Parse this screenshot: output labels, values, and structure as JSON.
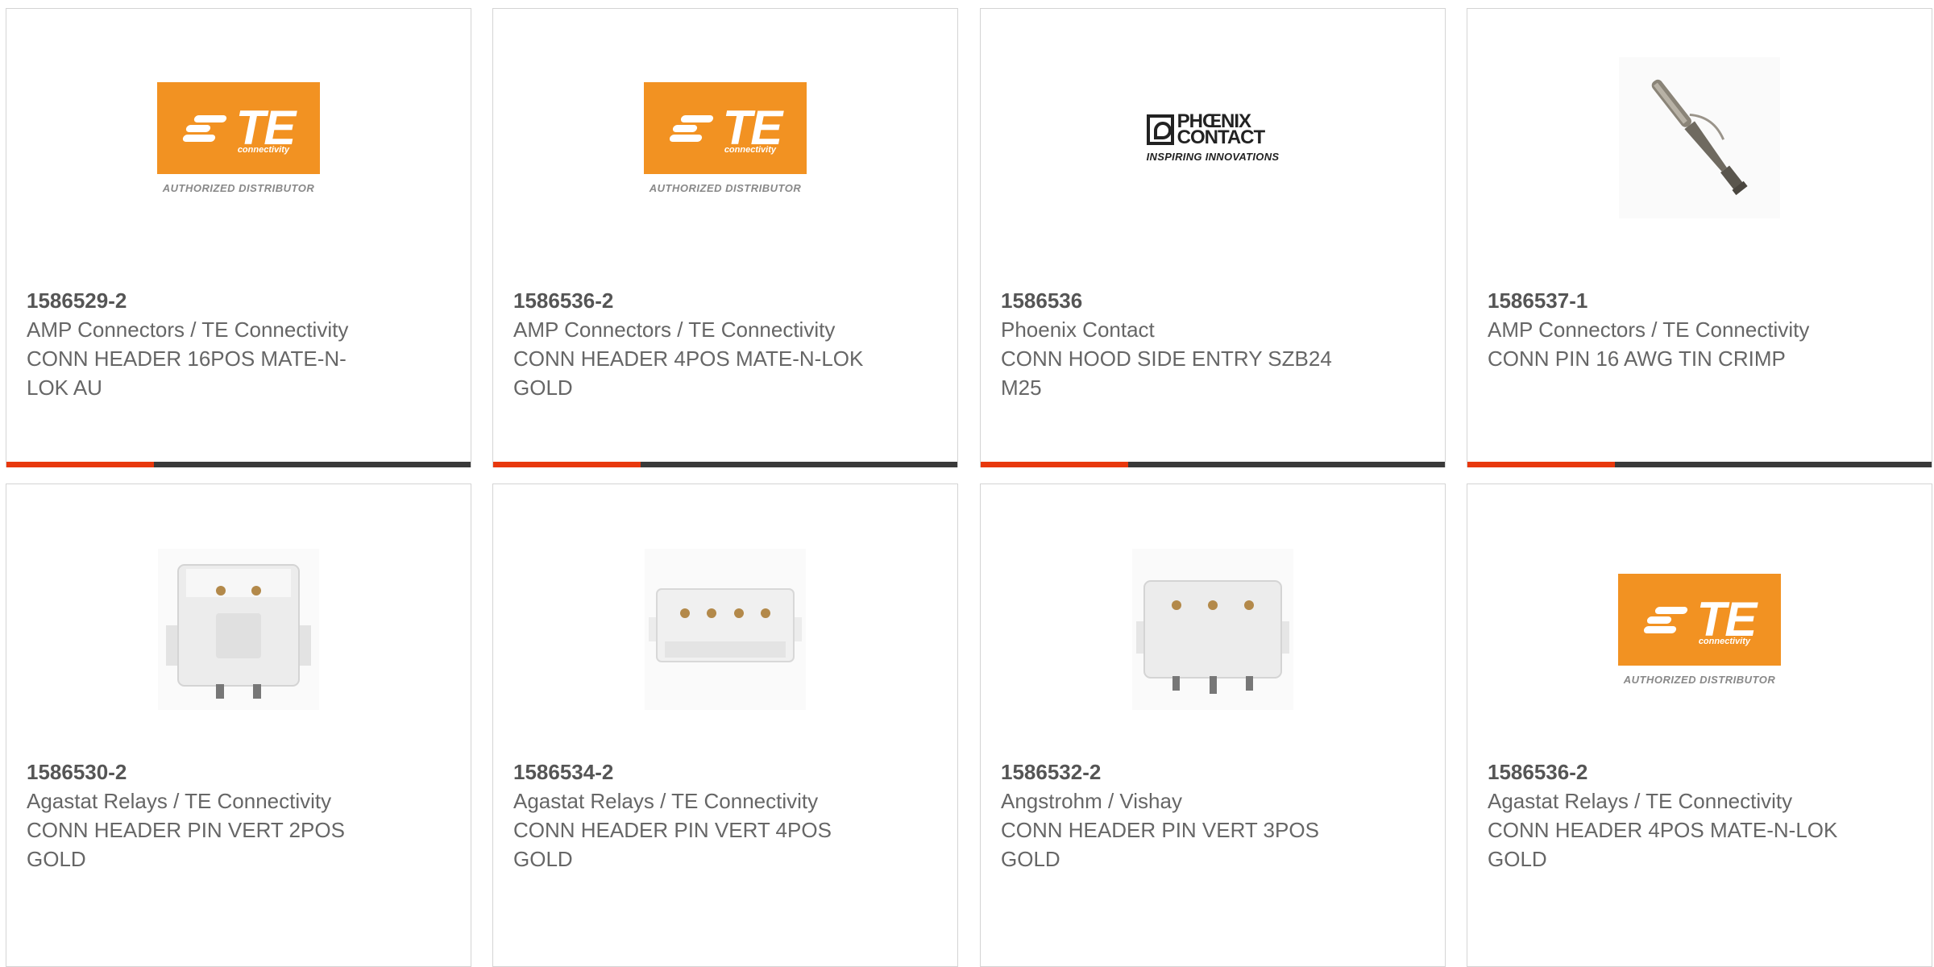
{
  "logos": {
    "te_text": "TE",
    "te_sub": "connectivity",
    "te_distributor": "AUTHORIZED DISTRIBUTOR",
    "phoenix_line1": "PHŒNIX",
    "phoenix_line2": "CONTACT",
    "phoenix_tagline": "INSPIRING INNOVATIONS"
  },
  "colors": {
    "te_orange": "#f29222",
    "accent_red": "#e8380d",
    "bar_dark": "#3a3a3a"
  },
  "products": [
    {
      "part_number": "1586529-2",
      "manufacturer": "AMP Connectors / TE Connectivity",
      "description": "CONN HEADER 16POS MATE-N-LOK AU",
      "image": "te-logo"
    },
    {
      "part_number": "1586536-2",
      "manufacturer": "AMP Connectors / TE Connectivity",
      "description": "CONN HEADER 4POS MATE-N-LOK GOLD",
      "image": "te-logo"
    },
    {
      "part_number": "1586536",
      "manufacturer": "Phoenix Contact",
      "description": "CONN HOOD SIDE ENTRY SZB24 M25",
      "image": "phoenix-logo"
    },
    {
      "part_number": "1586537-1",
      "manufacturer": "AMP Connectors / TE Connectivity",
      "description": "CONN PIN 16 AWG TIN CRIMP",
      "image": "crimp-pin"
    },
    {
      "part_number": "1586530-2",
      "manufacturer": "Agastat Relays / TE Connectivity",
      "description": "CONN HEADER PIN VERT 2POS GOLD",
      "image": "header-2pos"
    },
    {
      "part_number": "1586534-2",
      "manufacturer": "Agastat Relays / TE Connectivity",
      "description": "CONN HEADER PIN VERT 4POS GOLD",
      "image": "header-4pos"
    },
    {
      "part_number": "1586532-2",
      "manufacturer": "Angstrohm / Vishay",
      "description": "CONN HEADER PIN VERT 3POS GOLD",
      "image": "header-3pos"
    },
    {
      "part_number": "1586536-2",
      "manufacturer": "Agastat Relays / TE Connectivity",
      "description": "CONN HEADER 4POS MATE-N-LOK GOLD",
      "image": "te-logo"
    }
  ]
}
